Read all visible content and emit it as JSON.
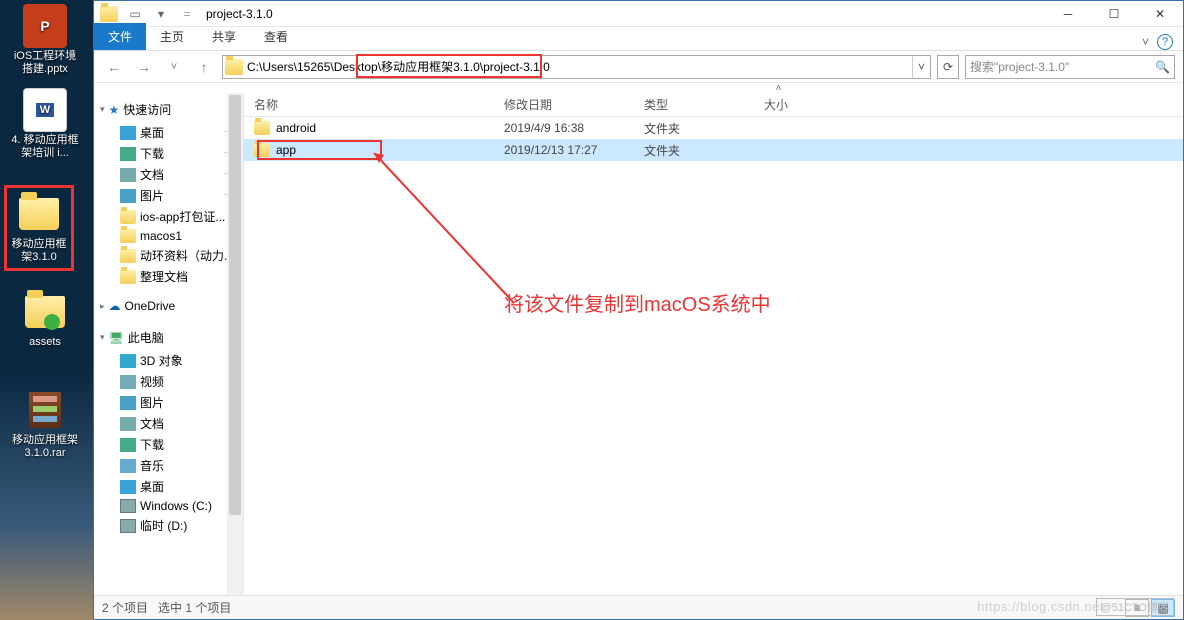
{
  "desktop": {
    "icons": [
      {
        "label": "iOS工程环境搭建.pptx",
        "type": "pptx"
      },
      {
        "label": "4. 移动应用框架培训 i...",
        "type": "docx"
      },
      {
        "label": "移动应用框架3.1.0",
        "type": "folder",
        "highlighted": true
      },
      {
        "label": "assets",
        "type": "folder-green"
      },
      {
        "label": "移动应用框架3.1.0.rar",
        "type": "rar"
      }
    ]
  },
  "explorer": {
    "window_title": "project-3.1.0",
    "ribbon_tabs": {
      "file": "文件",
      "home": "主页",
      "share": "共享",
      "view": "查看"
    },
    "address_path": "C:\\Users\\15265\\Desktop\\移动应用框架3.1.0\\project-3.1.0",
    "search_placeholder": "搜索\"project-3.1.0\"",
    "nav": {
      "quick_access": "快速访问",
      "items": [
        {
          "label": "桌面",
          "pin": true,
          "icon": "desktop"
        },
        {
          "label": "下载",
          "pin": true,
          "icon": "download"
        },
        {
          "label": "文档",
          "pin": true,
          "icon": "doc"
        },
        {
          "label": "图片",
          "pin": true,
          "icon": "picture"
        },
        {
          "label": "ios-app打包证...",
          "icon": "folder"
        },
        {
          "label": "macos1",
          "icon": "folder"
        },
        {
          "label": "动环资料（动力...",
          "icon": "folder"
        },
        {
          "label": "整理文档",
          "icon": "folder"
        }
      ],
      "onedrive": "OneDrive",
      "this_pc": "此电脑",
      "pc_items": [
        {
          "label": "3D 对象",
          "icon": "3d"
        },
        {
          "label": "视频",
          "icon": "video"
        },
        {
          "label": "图片",
          "icon": "picture"
        },
        {
          "label": "文档",
          "icon": "doc"
        },
        {
          "label": "下载",
          "icon": "download"
        },
        {
          "label": "音乐",
          "icon": "music"
        },
        {
          "label": "桌面",
          "icon": "desktop"
        },
        {
          "label": "Windows (C:)",
          "icon": "drive"
        },
        {
          "label": "临时 (D:)",
          "icon": "drive"
        }
      ]
    },
    "columns": {
      "name": "名称",
      "date": "修改日期",
      "type": "类型",
      "size": "大小"
    },
    "rows": [
      {
        "name": "android",
        "date": "2019/4/9 16:38",
        "type": "文件夹",
        "selected": false
      },
      {
        "name": "app",
        "date": "2019/12/13 17:27",
        "type": "文件夹",
        "selected": true
      }
    ],
    "status": {
      "count": "2 个项目",
      "selected": "选中 1 个项目"
    }
  },
  "annotation": {
    "text": "将该文件复制到macOS系统中"
  },
  "watermark": "https://blog.csdn.net",
  "watermark2": "@51CTO博客"
}
